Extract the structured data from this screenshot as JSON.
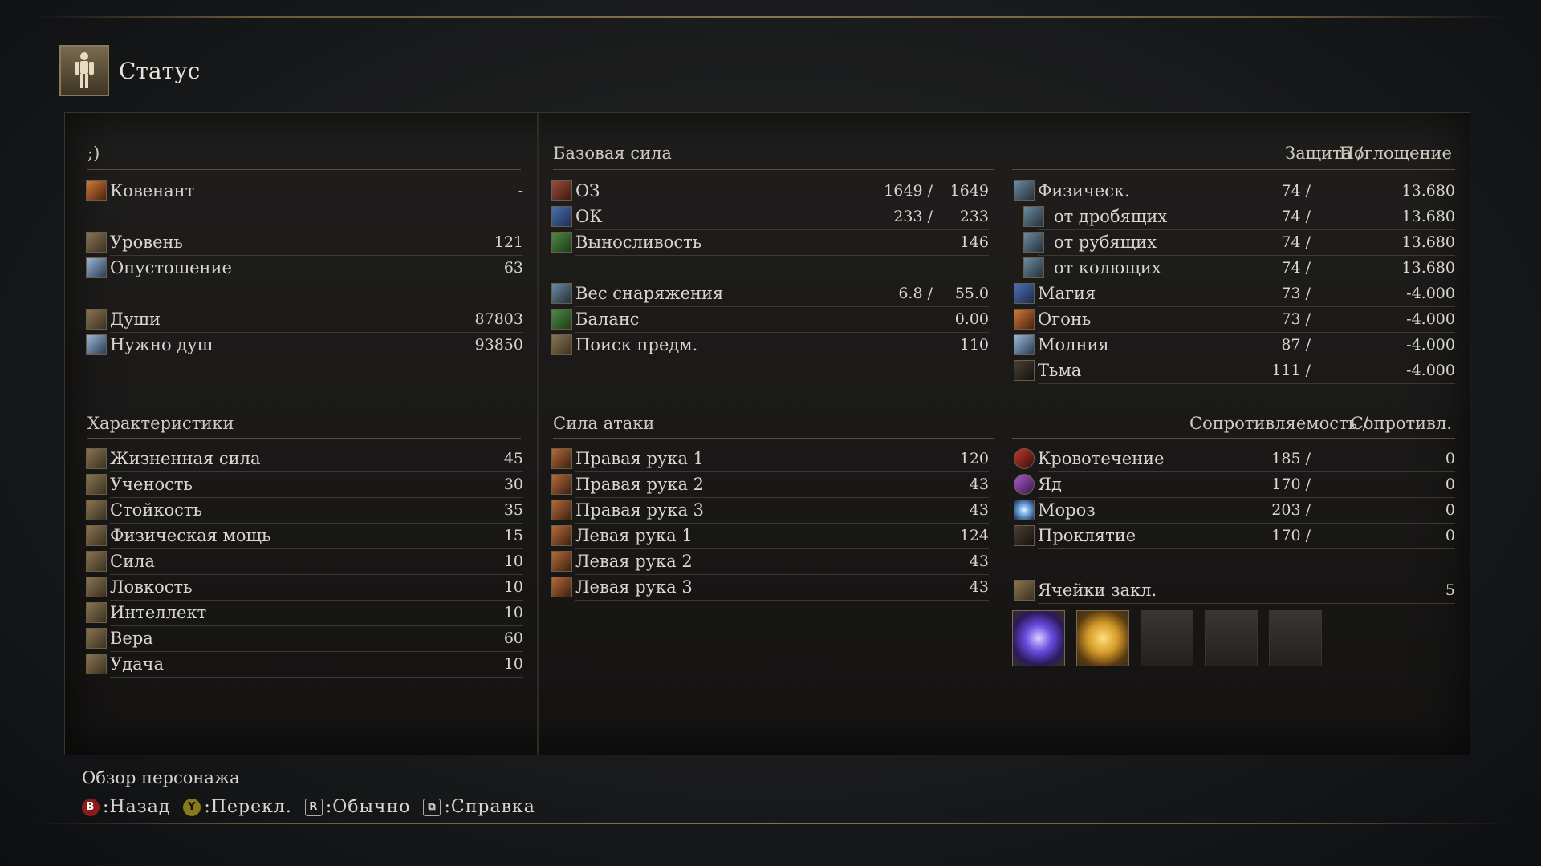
{
  "header": {
    "title": "Статус",
    "icon": "character-figure-icon"
  },
  "left": {
    "name": ";)",
    "covenant": {
      "label": "Ковенант",
      "value": "-"
    },
    "level": {
      "label": "Уровень",
      "value": "121"
    },
    "hollowing": {
      "label": "Опустошение",
      "value": "63"
    },
    "souls": {
      "label": "Души",
      "value": "87803"
    },
    "souls_needed": {
      "label": "Нужно душ",
      "value": "93850"
    },
    "attributes_title": "Характеристики",
    "attributes": [
      {
        "label": "Жизненная сила",
        "value": "45"
      },
      {
        "label": "Ученость",
        "value": "30"
      },
      {
        "label": "Стойкость",
        "value": "35"
      },
      {
        "label": "Физическая мощь",
        "value": "15"
      },
      {
        "label": "Сила",
        "value": "10"
      },
      {
        "label": "Ловкость",
        "value": "10"
      },
      {
        "label": "Интеллект",
        "value": "10"
      },
      {
        "label": "Вера",
        "value": "60"
      },
      {
        "label": "Удача",
        "value": "10"
      }
    ]
  },
  "middle": {
    "base_title": "Базовая сила",
    "hp": {
      "label": "ОЗ",
      "current": "1649 /",
      "max": "1649"
    },
    "fp": {
      "label": "ОК",
      "current": "233 /",
      "max": "233"
    },
    "stamina": {
      "label": "Выносливость",
      "value": "146"
    },
    "equip_load": {
      "label": "Вес снаряжения",
      "current": "6.8 /",
      "max": "55.0"
    },
    "poise": {
      "label": "Баланс",
      "value": "0.00"
    },
    "discovery": {
      "label": "Поиск предм.",
      "value": "110"
    },
    "attack_title": "Сила атаки",
    "attacks": [
      {
        "label": "Правая рука 1",
        "value": "120"
      },
      {
        "label": "Правая рука 2",
        "value": "43"
      },
      {
        "label": "Правая рука 3",
        "value": "43"
      },
      {
        "label": "Левая рука 1",
        "value": "124"
      },
      {
        "label": "Левая рука 2",
        "value": "43"
      },
      {
        "label": "Левая рука 3",
        "value": "43"
      }
    ]
  },
  "right": {
    "defense_header": {
      "col1": "Защита /",
      "col2": "Поглощение"
    },
    "defense": [
      {
        "label": "Физическ.",
        "def": "74 /",
        "abs": "13.680",
        "indent": false
      },
      {
        "label": "от дробящих",
        "def": "74 /",
        "abs": "13.680",
        "indent": true
      },
      {
        "label": "от рубящих",
        "def": "74 /",
        "abs": "13.680",
        "indent": true
      },
      {
        "label": "от колющих",
        "def": "74 /",
        "abs": "13.680",
        "indent": true
      },
      {
        "label": "Магия",
        "def": "73 /",
        "abs": "-4.000",
        "indent": false
      },
      {
        "label": "Огонь",
        "def": "73 /",
        "abs": "-4.000",
        "indent": false
      },
      {
        "label": "Молния",
        "def": "87 /",
        "abs": "-4.000",
        "indent": false
      },
      {
        "label": "Тьма",
        "def": "111 /",
        "abs": "-4.000",
        "indent": false
      }
    ],
    "resist_header": {
      "col1": "Сопротивляемость /",
      "col2": "Сопротивл."
    },
    "resist": [
      {
        "label": "Кровотечение",
        "val": "185 /",
        "cur": "0"
      },
      {
        "label": "Яд",
        "val": "170 /",
        "cur": "0"
      },
      {
        "label": "Мороз",
        "val": "203 /",
        "cur": "0"
      },
      {
        "label": "Проклятие",
        "val": "170 /",
        "cur": "0"
      }
    ],
    "slots": {
      "label": "Ячейки закл.",
      "value": "5"
    }
  },
  "footer": {
    "title": "Обзор персонажа",
    "controls": [
      {
        "key": "B",
        "label": ":Назад"
      },
      {
        "key": "Y",
        "label": ":Перекл."
      },
      {
        "key": "R",
        "label": ":Обычно"
      },
      {
        "key": "⧉",
        "label": ":Справка"
      }
    ]
  }
}
